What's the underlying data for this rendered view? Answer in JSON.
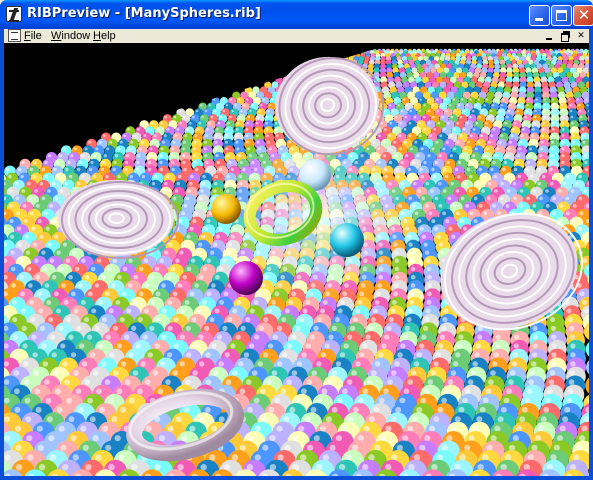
{
  "window": {
    "title": "RIBPreview - [ManySpheres.rib]",
    "icon": "rib-app-icon"
  },
  "titlebar_buttons": {
    "minimize": "minimize-icon",
    "maximize": "maximize-icon",
    "close": "close-icon",
    "close_glyph": "✕"
  },
  "menubar": {
    "file_first": "F",
    "file_rest": "ile",
    "window_first": "W",
    "window_rest": "indow",
    "help_first": "H",
    "help_rest": "elp"
  },
  "scene": {
    "background": "#000000",
    "description_icon": "render-viewport"
  }
}
